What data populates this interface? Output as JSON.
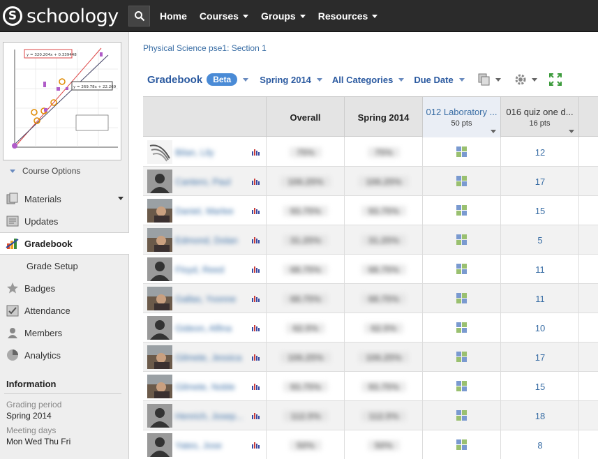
{
  "app": {
    "logo_text": "schoology",
    "logo_mark": "S",
    "nav": [
      "Home",
      "Courses",
      "Groups",
      "Resources"
    ]
  },
  "sidebar": {
    "course_options": "Course Options",
    "items": [
      {
        "label": "Materials",
        "icon": "materials-icon"
      },
      {
        "label": "Updates",
        "icon": "updates-icon"
      },
      {
        "label": "Gradebook",
        "icon": "gradebook-icon"
      },
      {
        "label": "Grade Setup",
        "icon": ""
      },
      {
        "label": "Badges",
        "icon": "star-icon"
      },
      {
        "label": "Attendance",
        "icon": "attendance-icon"
      },
      {
        "label": "Members",
        "icon": "members-icon"
      },
      {
        "label": "Analytics",
        "icon": "analytics-icon"
      }
    ],
    "information": {
      "heading": "Information",
      "grading_period_label": "Grading period",
      "grading_period_value": "Spring 2014",
      "meeting_days_label": "Meeting days",
      "meeting_days_value": "Mon Wed Thu Fri"
    },
    "course_image_text": {
      "eq1": "y = 320.204x + 0.339448",
      "eq2": "y = 269.78x + 22.269"
    }
  },
  "main": {
    "breadcrumb": "Physical Science pse1: Section 1",
    "toolbar": {
      "title": "Gradebook",
      "beta": "Beta",
      "period": "Spring 2014",
      "categories": "All Categories",
      "sort": "Due Date"
    },
    "columns": {
      "overall": "Overall",
      "spring": "Spring 2014",
      "lab_title": "012 Laboratory ...",
      "lab_pts": "50 pts",
      "quiz_title": "016 quiz one d...",
      "quiz_pts": "16 pts"
    },
    "rows": [
      {
        "name": "Bilan, Lily",
        "overall": "75%",
        "spring": "75%",
        "quiz": "12",
        "avatar": "logo"
      },
      {
        "name": "Cantero, Paul",
        "overall": "106.25%",
        "spring": "106.25%",
        "quiz": "17",
        "avatar": "silhouette"
      },
      {
        "name": "Daniel, Marlee",
        "overall": "93.75%",
        "spring": "93.75%",
        "quiz": "15",
        "avatar": "photo"
      },
      {
        "name": "Edmond, Dolan",
        "overall": "31.25%",
        "spring": "31.25%",
        "quiz": "5",
        "avatar": "photo"
      },
      {
        "name": "Floyd, Reed",
        "overall": "68.75%",
        "spring": "68.75%",
        "quiz": "11",
        "avatar": "silhouette"
      },
      {
        "name": "Gallas, Yvonne",
        "overall": "68.75%",
        "spring": "68.75%",
        "quiz": "11",
        "avatar": "photo"
      },
      {
        "name": "Gideon, Alfina",
        "overall": "62.5%",
        "spring": "62.5%",
        "quiz": "10",
        "avatar": "silhouette"
      },
      {
        "name": "Gilmete, Jessica",
        "overall": "106.25%",
        "spring": "106.25%",
        "quiz": "17",
        "avatar": "photo"
      },
      {
        "name": "Gilmete, Noble",
        "overall": "93.75%",
        "spring": "93.75%",
        "quiz": "15",
        "avatar": "photo"
      },
      {
        "name": "Henrich, Josep...",
        "overall": "112.5%",
        "spring": "112.5%",
        "quiz": "18",
        "avatar": "silhouette"
      },
      {
        "name": "Yates, Jose",
        "overall": "50%",
        "spring": "50%",
        "quiz": "8",
        "avatar": "silhouette"
      }
    ]
  },
  "colors": {
    "topbar": "#2b2b2b",
    "link": "#3a6ea5",
    "title_blue": "#2b5aa0",
    "beta": "#4a8bd6"
  }
}
